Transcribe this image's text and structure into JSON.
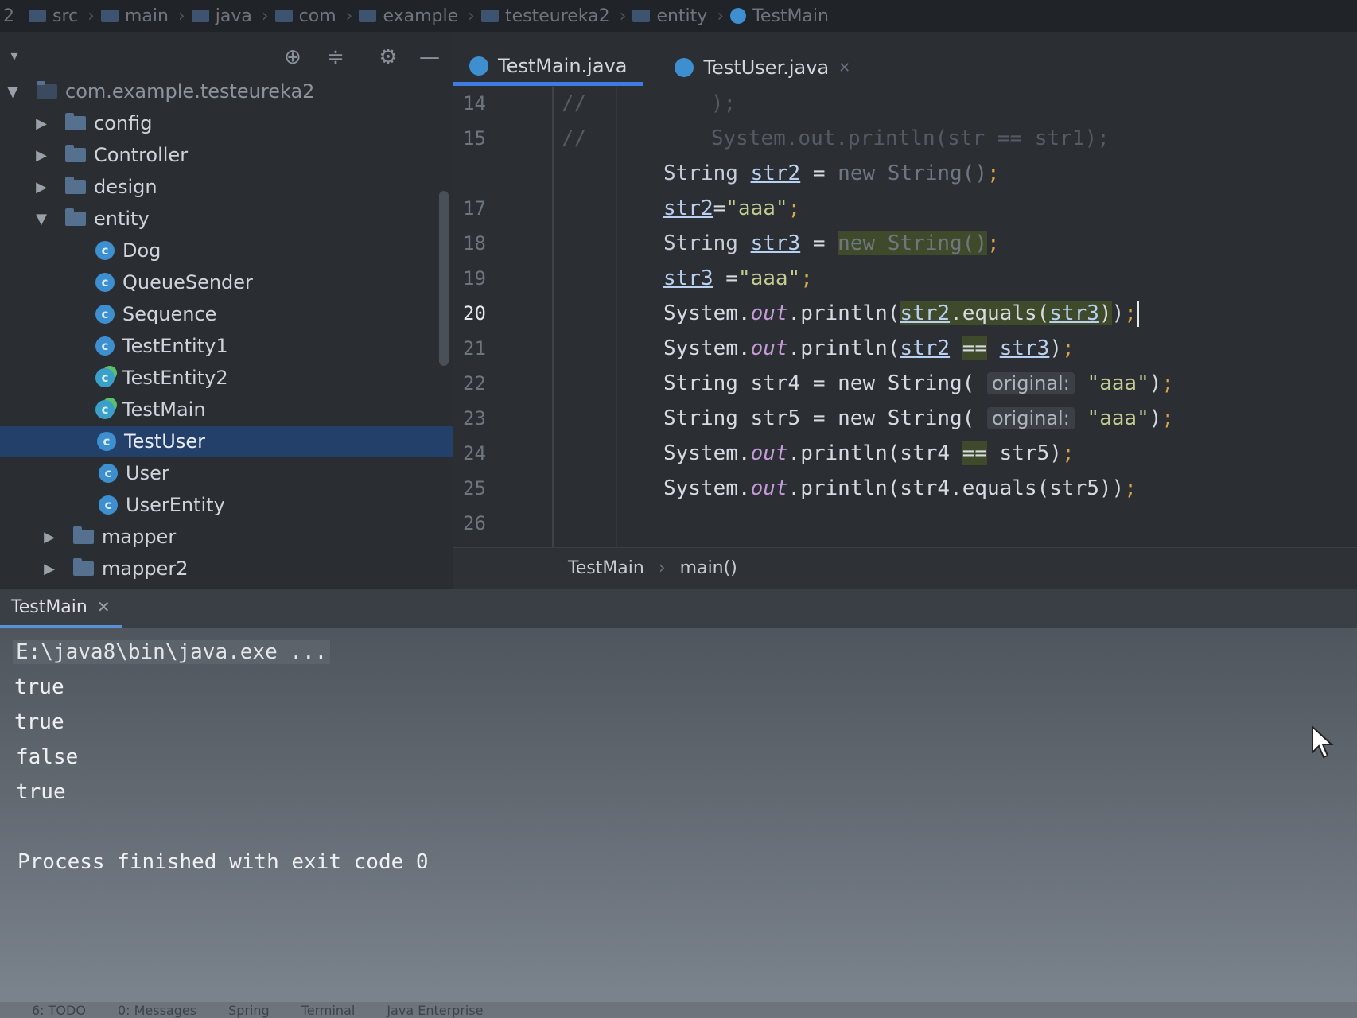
{
  "breadcrumb": [
    "src",
    "main",
    "java",
    "com",
    "example",
    "testeureka2",
    "entity",
    "TestMain"
  ],
  "breadcrumb_prefix": "2",
  "project": {
    "root": "com.example.testeureka2",
    "items": [
      {
        "label": "config",
        "type": "folder",
        "level": 1,
        "expanded": false
      },
      {
        "label": "Controller",
        "type": "folder",
        "level": 1,
        "expanded": false
      },
      {
        "label": "design",
        "type": "folder",
        "level": 1,
        "expanded": false
      },
      {
        "label": "entity",
        "type": "folder",
        "level": 1,
        "expanded": true
      },
      {
        "label": "Dog",
        "type": "class",
        "level": 2
      },
      {
        "label": "QueueSender",
        "type": "class",
        "level": 2
      },
      {
        "label": "Sequence",
        "type": "class",
        "level": 2
      },
      {
        "label": "TestEntity1",
        "type": "class",
        "level": 2
      },
      {
        "label": "TestEntity2",
        "type": "runnable",
        "level": 2
      },
      {
        "label": "TestMain",
        "type": "runnable",
        "level": 2
      },
      {
        "label": "TestUser",
        "type": "class",
        "level": 2,
        "selected": true
      },
      {
        "label": "User",
        "type": "class",
        "level": 2
      },
      {
        "label": "UserEntity",
        "type": "class",
        "level": 2
      },
      {
        "label": "mapper",
        "type": "folder",
        "level": 1,
        "expanded": false
      },
      {
        "label": "mapper2",
        "type": "folder",
        "level": 1,
        "expanded": false
      }
    ]
  },
  "editor": {
    "tabs": [
      {
        "label": "TestMain.java",
        "active": true
      },
      {
        "label": "TestUser.java",
        "active": false
      }
    ],
    "line_numbers": [
      "14",
      "15",
      "",
      "17",
      "18",
      "19",
      "20",
      "21",
      "22",
      "23",
      "24",
      "25",
      "26"
    ],
    "current_line": "20",
    "faded_lines": {
      "l14": "//          );",
      "l15": "//          System.out.println(str == str1);"
    },
    "hint_label": "original:",
    "code_breadcrumb": {
      "class": "TestMain",
      "method": "main()"
    }
  },
  "run": {
    "tab_label": "TestMain",
    "command": "E:\\java8\\bin\\java.exe ...",
    "output": [
      "true",
      "true",
      "false",
      "true"
    ],
    "exit_message": "Process finished with exit code 0"
  },
  "bottom_tools": [
    "6: TODO",
    "0: Messages",
    "Spring",
    "Terminal",
    "Java Enterprise"
  ],
  "colors": {
    "accent": "#3f7be0",
    "selection": "#23406b"
  }
}
